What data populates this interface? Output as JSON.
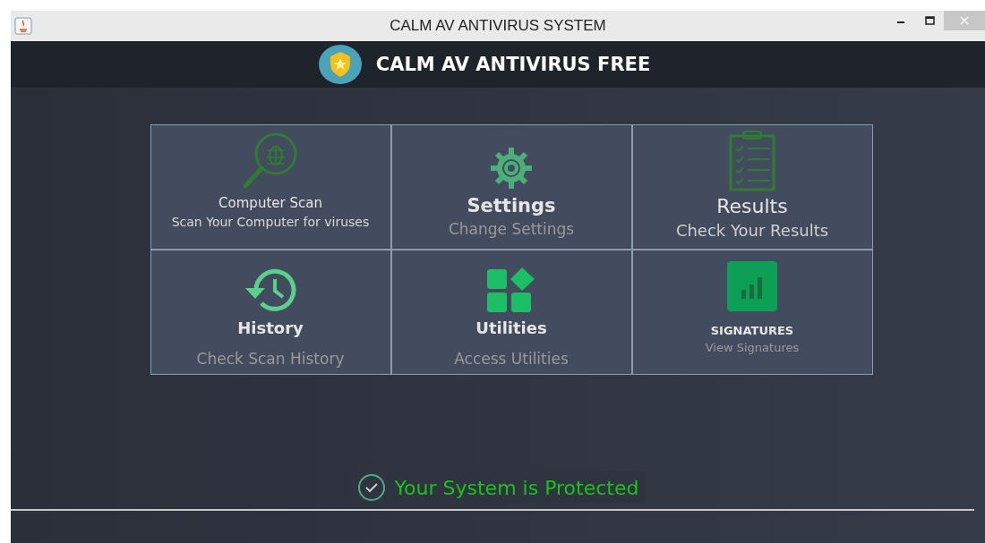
{
  "window": {
    "title": "CALM AV ANTIVIRUS SYSTEM"
  },
  "header": {
    "title": "CALM AV ANTIVIRUS FREE"
  },
  "tiles": [
    {
      "kind": "scan",
      "title": "Computer Scan",
      "subtitle": "Scan Your Computer for viruses"
    },
    {
      "kind": "settings",
      "title": "Settings",
      "subtitle": "Change Settings"
    },
    {
      "kind": "results",
      "title": "Results",
      "subtitle": "Check Your Results"
    },
    {
      "kind": "history",
      "title": "History",
      "subtitle": "Check Scan History"
    },
    {
      "kind": "utilities",
      "title": "Utilities",
      "subtitle": "Access Utilities"
    },
    {
      "kind": "signatures",
      "title": "SIGNATURES",
      "subtitle": "View Signatures"
    }
  ],
  "status": {
    "text": "Your System is Protected"
  }
}
